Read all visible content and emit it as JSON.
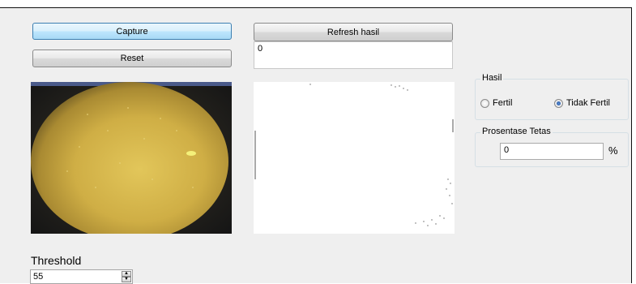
{
  "buttons": {
    "capture_label": "Capture",
    "reset_label": "Reset",
    "refresh_label": "Refresh hasil"
  },
  "output_box": {
    "value": "0"
  },
  "hasil": {
    "title": "Hasil",
    "options": [
      {
        "label": "Fertil",
        "checked": false
      },
      {
        "label": "Tidak Fertil",
        "checked": true
      }
    ]
  },
  "prosentase": {
    "title": "Prosentase Tetas",
    "value": "0",
    "unit": "%"
  },
  "threshold": {
    "label": "Threshold",
    "value": "55"
  },
  "colors": {
    "window_bg": "#efefef",
    "focused_button": "#bee6fd",
    "egg_yellow": "#c9a83d"
  },
  "icons": {
    "step_up": "up-arrow-icon",
    "step_down": "down-arrow-icon",
    "radio_checked": "radio-selected-icon"
  }
}
